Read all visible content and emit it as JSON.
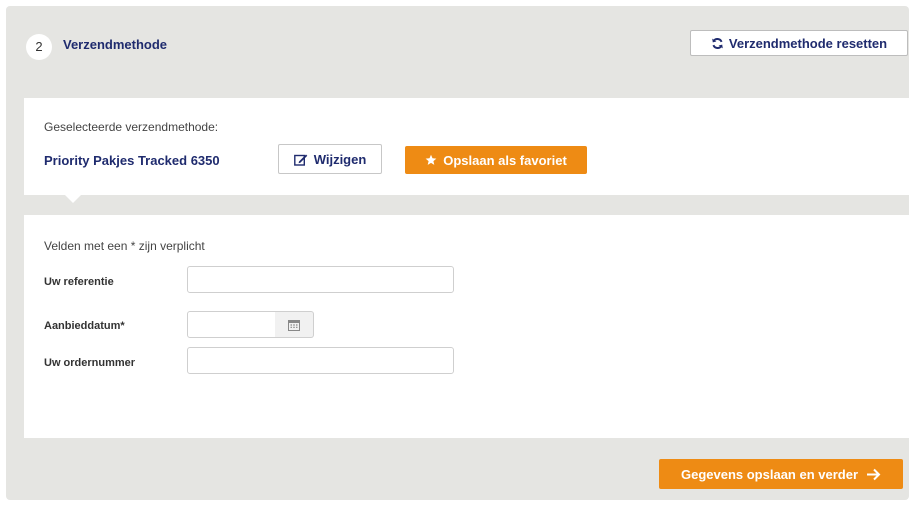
{
  "step": {
    "number": "2",
    "title": "Verzendmethode"
  },
  "header": {
    "reset_label": "Verzendmethode resetten"
  },
  "selection": {
    "label": "Geselecteerde verzendmethode:",
    "value": "Priority Pakjes Tracked 6350",
    "edit_label": "Wijzigen",
    "favorite_label": "Opslaan als favoriet"
  },
  "form": {
    "required_note": "Velden met een * zijn verplicht",
    "fields": [
      {
        "label": "Uw referentie",
        "value": ""
      },
      {
        "label": "Aanbieddatum*",
        "value": ""
      },
      {
        "label": "Uw ordernummer",
        "value": ""
      }
    ]
  },
  "footer": {
    "next_label": "Gegevens opslaan en verder"
  },
  "colors": {
    "accent": "#ee8b14",
    "title": "#1f2b6e",
    "panel": "#e5e5e2"
  },
  "icons": {
    "reset": "refresh-icon",
    "edit": "edit-icon",
    "favorite": "star-icon",
    "calendar": "calendar-icon",
    "next": "arrow-right-icon"
  }
}
